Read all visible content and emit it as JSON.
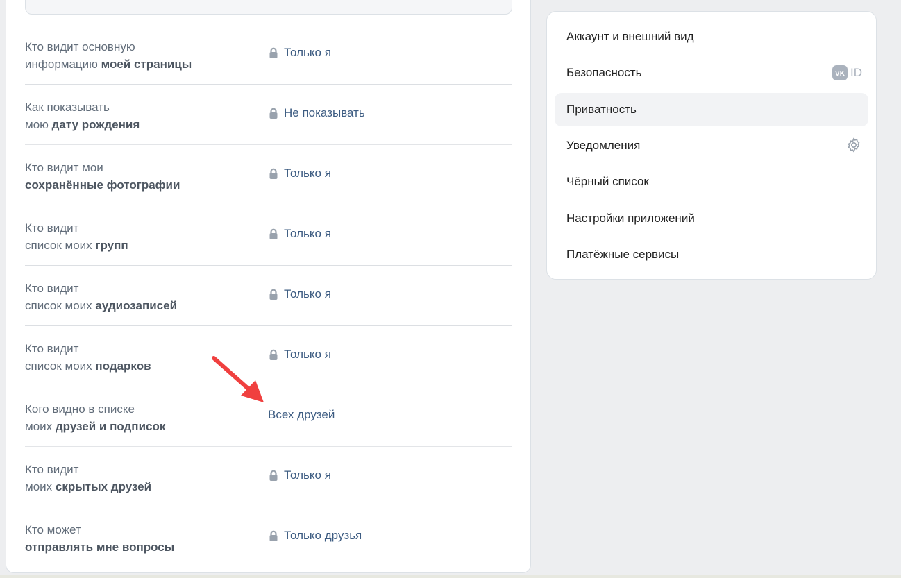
{
  "privacy_rows": [
    {
      "line1": "Кто видит основную",
      "line2_pre": "информацию ",
      "line2_bold": "моей страницы",
      "value": "Только я",
      "locked": true
    },
    {
      "line1": "Как показывать",
      "line2_pre": "мою ",
      "line2_bold": "дату рождения",
      "value": "Не показывать",
      "locked": true
    },
    {
      "line1": "Кто видит мои",
      "line2_pre": "",
      "line2_bold": "сохранённые фотографии",
      "value": "Только я",
      "locked": true
    },
    {
      "line1": "Кто видит",
      "line2_pre": "список моих ",
      "line2_bold": "групп",
      "value": "Только я",
      "locked": true
    },
    {
      "line1": "Кто видит",
      "line2_pre": "список моих ",
      "line2_bold": "аудиозаписей",
      "value": "Только я",
      "locked": true
    },
    {
      "line1": "Кто видит",
      "line2_pre": "список моих ",
      "line2_bold": "подарков",
      "value": "Только я",
      "locked": true
    },
    {
      "line1": "Кого видно в списке",
      "line2_pre": "моих ",
      "line2_bold": "друзей и подписок",
      "value": "Всех друзей",
      "locked": false
    },
    {
      "line1": "Кто видит",
      "line2_pre": "моих ",
      "line2_bold": "скрытых друзей",
      "value": "Только я",
      "locked": true
    },
    {
      "line1": "Кто может",
      "line2_pre": "",
      "line2_bold": "отправлять мне вопросы",
      "value": "Только друзья",
      "locked": true
    }
  ],
  "settings_menu": {
    "items": [
      {
        "label": "Аккаунт и внешний вид",
        "icon": null
      },
      {
        "label": "Безопасность",
        "icon": "vk-id-icon",
        "icon_text": "ID"
      },
      {
        "label": "Приватность",
        "icon": null,
        "active": true
      },
      {
        "label": "Уведомления",
        "icon": "gear-icon"
      },
      {
        "label": "Чёрный список",
        "icon": null
      },
      {
        "label": "Настройки приложений",
        "icon": null
      },
      {
        "label": "Платёжные сервисы",
        "icon": null
      }
    ]
  },
  "colors": {
    "background": "#edeef0",
    "card": "#ffffff",
    "link_value": "#3d5c82",
    "label_text": "#626d7a",
    "active_menu_bg": "#f2f3f5",
    "annotation_arrow": "#f0403f"
  }
}
